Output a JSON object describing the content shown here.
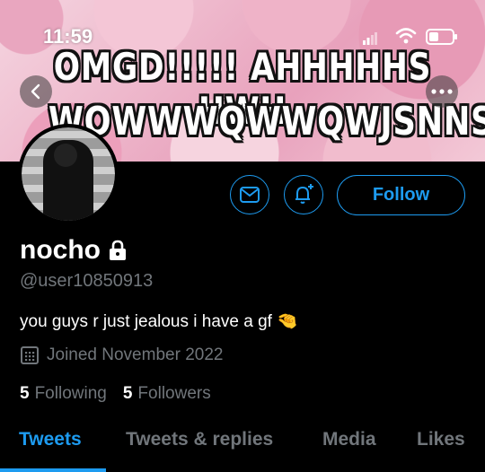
{
  "status": {
    "time": "11:59"
  },
  "banner": {
    "line1": "OMGD!!!!! AHHHHHS HWH",
    "line2": "WOWWWQWWQWJSNNS"
  },
  "profile": {
    "name": "nocho",
    "handle": "@user10850913",
    "bio": "you guys r just jealous i have a gf 🤏",
    "joined": "Joined November 2022",
    "following_count": "5",
    "following_label": "Following",
    "followers_count": "5",
    "followers_label": "Followers"
  },
  "actions": {
    "follow_label": "Follow"
  },
  "tabs": [
    "Tweets",
    "Tweets & replies",
    "Media",
    "Likes"
  ],
  "colors": {
    "accent": "#1d9bf0",
    "muted": "#71767b",
    "background": "#000000"
  },
  "icons": [
    "back-icon",
    "more-icon",
    "mail-icon",
    "bell-plus-icon",
    "lock-icon",
    "calendar-icon"
  ]
}
